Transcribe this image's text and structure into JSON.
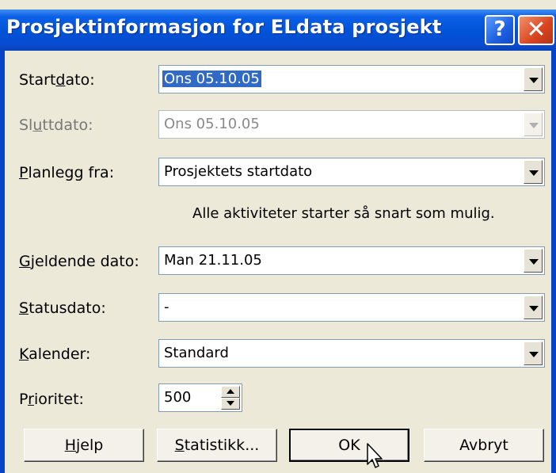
{
  "window": {
    "title": "Prosjektinformasjon for ELdata prosjekt",
    "help_icon": "?",
    "close_icon": "✕"
  },
  "fields": {
    "startdato": {
      "label": "Startdato:",
      "value": "Ons 05.10.05"
    },
    "sluttdato": {
      "label": "Sluttdato:",
      "value": "Ons 05.10.05"
    },
    "planlegg_fra": {
      "label": "Planlegg fra:",
      "value": "Prosjektets startdato"
    },
    "info_text": "Alle aktiviteter starter så snart som mulig.",
    "gjeldende_dato": {
      "label": "Gjeldende dato:",
      "value": "Man 21.11.05"
    },
    "statusdato": {
      "label": "Statusdato:",
      "value": "-"
    },
    "kalender": {
      "label": "Kalender:",
      "value": "Standard"
    },
    "prioritet": {
      "label": "Prioritet:",
      "value": "500"
    }
  },
  "buttons": {
    "hjelp": "Hjelp",
    "statistikk": "Statistikk...",
    "ok": "OK",
    "avbryt": "Avbryt"
  },
  "colors": {
    "titlebar": "#0A5FE6",
    "dialog_bg": "#ECE9D8",
    "selection": "#316AC5",
    "close_button": "#D8431E"
  }
}
